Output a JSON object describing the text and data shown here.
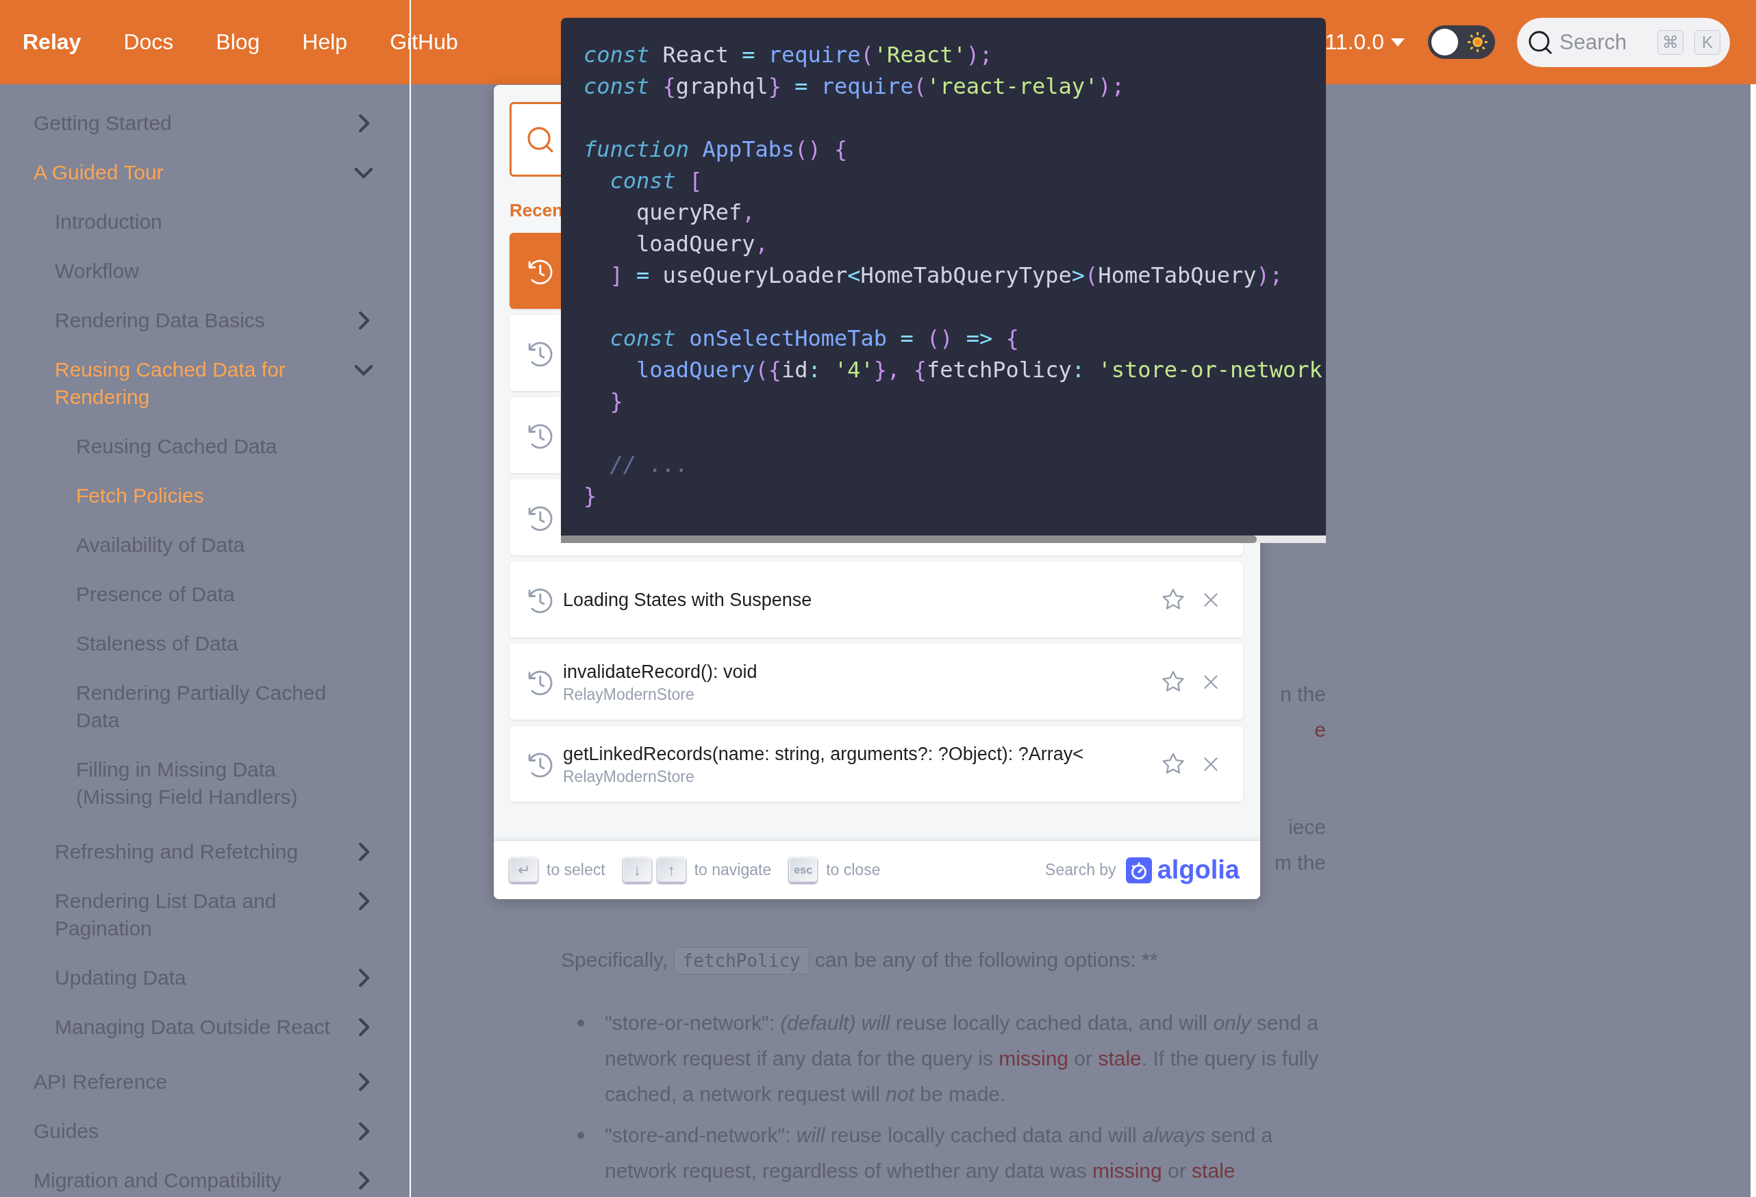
{
  "navbar": {
    "brand": "Relay",
    "links": [
      {
        "label": "Docs"
      },
      {
        "label": "Blog"
      },
      {
        "label": "Help"
      },
      {
        "label": "GitHub"
      }
    ],
    "version": "11.0.0",
    "theme_toggle": {
      "on": false
    },
    "search": {
      "placeholder": "Search",
      "keys": [
        "⌘",
        "K"
      ]
    }
  },
  "sidebar": {
    "items": [
      {
        "label": "Getting Started",
        "kind": "category",
        "active": false,
        "expanded": false
      },
      {
        "label": "A Guided Tour",
        "kind": "category",
        "active": true,
        "expanded": true,
        "children": [
          {
            "label": "Introduction",
            "kind": "page",
            "active": false
          },
          {
            "label": "Workflow",
            "kind": "page",
            "active": false
          },
          {
            "label": "Rendering Data Basics",
            "kind": "category",
            "active": false,
            "expanded": false
          },
          {
            "label": "Reusing Cached Data for Rendering",
            "kind": "category",
            "active": true,
            "expanded": true,
            "children": [
              {
                "label": "Reusing Cached Data",
                "kind": "page",
                "active": false
              },
              {
                "label": "Fetch Policies",
                "kind": "page",
                "active": true
              },
              {
                "label": "Availability of Data",
                "kind": "page",
                "active": false
              },
              {
                "label": "Presence of Data",
                "kind": "page",
                "active": false
              },
              {
                "label": "Staleness of Data",
                "kind": "page",
                "active": false
              },
              {
                "label": "Rendering Partially Cached Data",
                "kind": "page",
                "active": false
              },
              {
                "label": "Filling in Missing Data (Missing Field Handlers)",
                "kind": "page",
                "active": false
              }
            ]
          },
          {
            "label": "Refreshing and Refetching",
            "kind": "category",
            "active": false,
            "expanded": false
          },
          {
            "label": "Rendering List Data and Pagination",
            "kind": "category",
            "active": false,
            "expanded": false
          },
          {
            "label": "Updating Data",
            "kind": "category",
            "active": false,
            "expanded": false
          },
          {
            "label": "Managing Data Outside React",
            "kind": "category",
            "active": false,
            "expanded": false
          }
        ]
      },
      {
        "label": "API Reference",
        "kind": "category",
        "active": false,
        "expanded": false
      },
      {
        "label": "Guides",
        "kind": "category",
        "active": false,
        "expanded": false
      },
      {
        "label": "Migration and Compatibility",
        "kind": "category",
        "active": false,
        "expanded": false
      }
    ]
  },
  "content": {
    "paragraph_endings": [
      [
        {
          "kind": "text",
          "text": "n the"
        },
        {
          "kind": "link",
          "text": "e"
        }
      ],
      [
        {
          "kind": "text",
          "text": "iece"
        },
        {
          "kind": "text",
          "text": "m the"
        }
      ]
    ],
    "paragraphs": [
      [
        {
          "kind": "text",
          "text": "Specifically, "
        },
        {
          "kind": "code",
          "text": "fetchPolicy"
        },
        {
          "kind": "text",
          "text": " can be any of the following options: **"
        }
      ]
    ],
    "bullets": [
      [
        {
          "kind": "text",
          "text": "\"store-or-network\": "
        },
        {
          "kind": "italic",
          "text": "(default) will"
        },
        {
          "kind": "text",
          "text": " reuse locally cached data, and will "
        },
        {
          "kind": "italic",
          "text": "only"
        },
        {
          "kind": "text",
          "text": " send a network request if any data for the query is "
        },
        {
          "kind": "link",
          "text": "missing"
        },
        {
          "kind": "text",
          "text": " or "
        },
        {
          "kind": "link",
          "text": "stale"
        },
        {
          "kind": "text",
          "text": ". If the query is fully cached, a network request will "
        },
        {
          "kind": "italic",
          "text": "not"
        },
        {
          "kind": "text",
          "text": " be made."
        }
      ],
      [
        {
          "kind": "text",
          "text": "\"store-and-network\": "
        },
        {
          "kind": "italic",
          "text": "will"
        },
        {
          "kind": "text",
          "text": " reuse locally cached data and will "
        },
        {
          "kind": "italic",
          "text": "always"
        },
        {
          "kind": "text",
          "text": " send a network request, regardless of whether any data was "
        },
        {
          "kind": "link",
          "text": "missing"
        },
        {
          "kind": "text",
          "text": " or "
        },
        {
          "kind": "link",
          "text": "stale"
        }
      ]
    ]
  },
  "search_modal": {
    "section_heading": "Recen",
    "hits": [
      {
        "selected": true
      },
      {
        "selected": false
      },
      {
        "selected": false
      },
      {
        "selected": false
      },
      {
        "selected": false,
        "title": "Loading States with Suspense"
      },
      {
        "selected": false,
        "title": "invalidateRecord(): void",
        "subtitle": "RelayModernStore"
      },
      {
        "selected": false,
        "title": "getLinkedRecords(name: string, arguments?: ?Object): ?Array<",
        "subtitle": "RelayModernStore"
      }
    ],
    "footer": {
      "hints": [
        {
          "keys": [
            "↵"
          ],
          "label": "to select"
        },
        {
          "keys": [
            "↓",
            "↑"
          ],
          "label": "to navigate"
        },
        {
          "keys": [
            "esc"
          ],
          "label": "to close"
        }
      ],
      "search_by": "Search by",
      "provider": "algolia"
    }
  },
  "code_popup": {
    "lines": [
      {
        "kind": "code",
        "tokens": [
          {
            "kind": "kw",
            "text": "const"
          },
          {
            "kind": "plain",
            "text": " React "
          },
          {
            "kind": "op",
            "text": "= "
          },
          {
            "kind": "fn",
            "text": "require"
          },
          {
            "kind": "punct",
            "text": "("
          },
          {
            "kind": "str",
            "text": "'React'"
          },
          {
            "kind": "punct",
            "text": ");"
          }
        ]
      },
      {
        "kind": "code",
        "tokens": [
          {
            "kind": "kw",
            "text": "const"
          },
          {
            "kind": "punct",
            "text": " {"
          },
          {
            "kind": "plain",
            "text": "graphql"
          },
          {
            "kind": "punct",
            "text": "} "
          },
          {
            "kind": "op",
            "text": "= "
          },
          {
            "kind": "fn",
            "text": "require"
          },
          {
            "kind": "punct",
            "text": "("
          },
          {
            "kind": "str",
            "text": "'react-relay'"
          },
          {
            "kind": "punct",
            "text": ");"
          }
        ]
      },
      {
        "kind": "blank"
      },
      {
        "kind": "code",
        "tokens": [
          {
            "kind": "kw",
            "text": "function"
          },
          {
            "kind": "fn",
            "text": " AppTabs"
          },
          {
            "kind": "punct",
            "text": "() {"
          }
        ]
      },
      {
        "kind": "code",
        "tokens": [
          {
            "kind": "kw",
            "text": "  const"
          },
          {
            "kind": "punct",
            "text": " ["
          }
        ]
      },
      {
        "kind": "code",
        "tokens": [
          {
            "kind": "plain",
            "text": "    queryRef"
          },
          {
            "kind": "punct",
            "text": ","
          }
        ]
      },
      {
        "kind": "code",
        "tokens": [
          {
            "kind": "plain",
            "text": "    loadQuery"
          },
          {
            "kind": "punct",
            "text": ","
          }
        ]
      },
      {
        "kind": "code",
        "tokens": [
          {
            "kind": "punct",
            "text": "  ] "
          },
          {
            "kind": "op",
            "text": "="
          },
          {
            "kind": "plain",
            "text": " useQueryLoader"
          },
          {
            "kind": "op",
            "text": "<"
          },
          {
            "kind": "plain",
            "text": "HomeTabQueryType"
          },
          {
            "kind": "op",
            "text": ">"
          },
          {
            "kind": "punct",
            "text": "("
          },
          {
            "kind": "plain",
            "text": "HomeTabQuery"
          },
          {
            "kind": "punct",
            "text": ");"
          }
        ]
      },
      {
        "kind": "blank"
      },
      {
        "kind": "code",
        "tokens": [
          {
            "kind": "kw",
            "text": "  const"
          },
          {
            "kind": "fn",
            "text": " onSelectHomeTab"
          },
          {
            "kind": "op",
            "text": " = "
          },
          {
            "kind": "punct",
            "text": "() "
          },
          {
            "kind": "op",
            "text": "=> "
          },
          {
            "kind": "punct",
            "text": "{"
          }
        ]
      },
      {
        "kind": "code",
        "tokens": [
          {
            "kind": "fn",
            "text": "    loadQuery"
          },
          {
            "kind": "punct",
            "text": "({"
          },
          {
            "kind": "plain",
            "text": "id"
          },
          {
            "kind": "op",
            "text": ": "
          },
          {
            "kind": "str",
            "text": "'4'"
          },
          {
            "kind": "punct",
            "text": "}, {"
          },
          {
            "kind": "plain",
            "text": "fetchPolicy"
          },
          {
            "kind": "op",
            "text": ": "
          },
          {
            "kind": "str",
            "text": "'store-or-network"
          }
        ]
      },
      {
        "kind": "code",
        "tokens": [
          {
            "kind": "punct",
            "text": "  }"
          }
        ]
      },
      {
        "kind": "blank"
      },
      {
        "kind": "code",
        "tokens": [
          {
            "kind": "comment",
            "text": "  // ..."
          }
        ]
      },
      {
        "kind": "code",
        "tokens": [
          {
            "kind": "punct",
            "text": "}"
          }
        ]
      }
    ]
  }
}
